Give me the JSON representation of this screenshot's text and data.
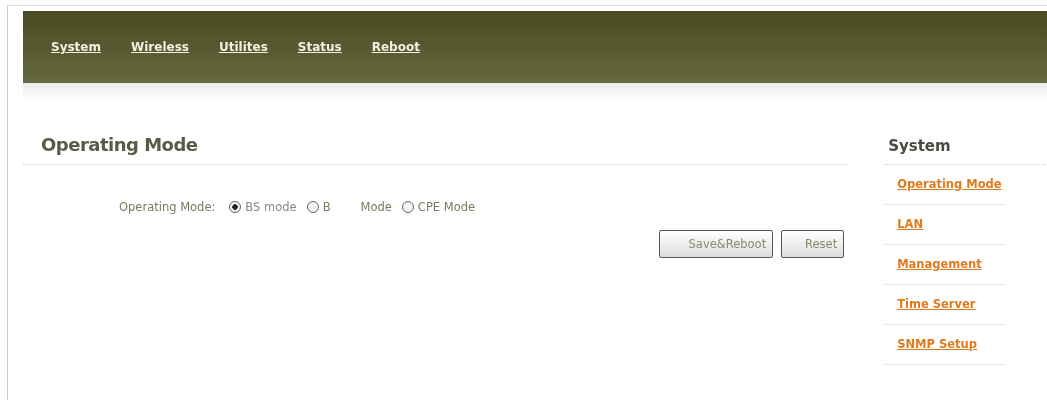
{
  "nav": [
    {
      "label": "System"
    },
    {
      "label": "Wireless"
    },
    {
      "label": "Utilites"
    },
    {
      "label": "Status"
    },
    {
      "label": "Reboot"
    }
  ],
  "main": {
    "title": "Operating Mode",
    "field_label": "Operating Mode:",
    "options": [
      {
        "label": "BS mode",
        "selected": true
      },
      {
        "label": "B",
        "suffix": "Mode",
        "selected": false
      },
      {
        "label": "CPE Mode",
        "selected": false
      }
    ],
    "buttons": [
      "Save&Reboot",
      "Reset"
    ]
  },
  "sidebar": {
    "title": "System",
    "links": [
      "Operating Mode",
      "LAN",
      "Management",
      "Time Server",
      "SNMP Setup"
    ]
  }
}
